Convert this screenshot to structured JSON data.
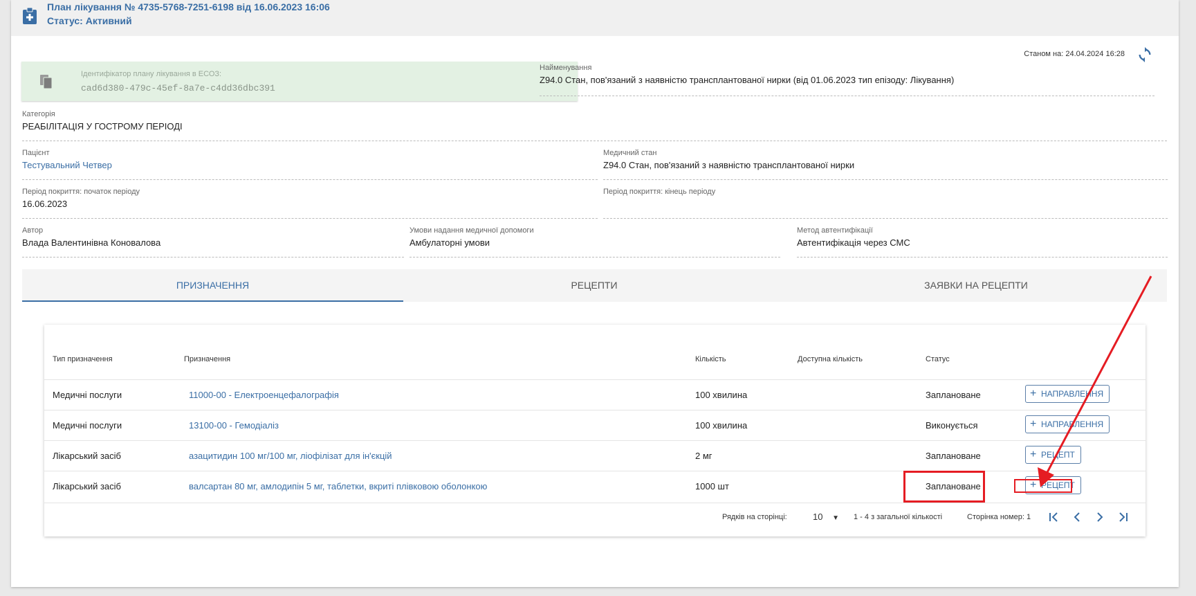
{
  "header": {
    "title": "План лікування № 4735-5768-7251-6198 від 16.06.2023 16:06",
    "status": "Статус: Активний"
  },
  "as_of": "Станом на: 24.04.2024 16:28",
  "ehealth_id": {
    "label": "Ідентифікатор плану лікування в ЕСОЗ:",
    "value": "cad6d380-479c-45ef-8a7e-c4dd36dbc391"
  },
  "fields": {
    "name": {
      "label": "Найменування",
      "value": "Z94.0 Стан, пов'язаний з наявністю трансплантованої нирки (від 01.06.2023 тип епізоду: Лікування)"
    },
    "category": {
      "label": "Категорія",
      "value": "РЕАБІЛІТАЦІЯ У ГОСТРОМУ ПЕРІОДІ"
    },
    "patient": {
      "label": "Пацієнт",
      "value": "Тестувальний Четвер"
    },
    "condition": {
      "label": "Медичний стан",
      "value": "Z94.0 Стан, пов'язаний з наявністю трансплантованої нирки"
    },
    "period_start": {
      "label": "Період покриття: початок періоду",
      "value": "16.06.2023"
    },
    "period_end": {
      "label": "Період покриття: кінець періоду",
      "value": ""
    },
    "author": {
      "label": "Автор",
      "value": "Влада Валентинівна Коновалова"
    },
    "care_conditions": {
      "label": "Умови надання медичної допомоги",
      "value": "Амбулаторні умови"
    },
    "auth_method": {
      "label": "Метод автентифікації",
      "value": "Автентифікація через СМС"
    }
  },
  "tabs": [
    "ПРИЗНАЧЕННЯ",
    "РЕЦЕПТИ",
    "ЗАЯВКИ НА РЕЦЕПТИ"
  ],
  "table": {
    "columns": [
      "Тип призначення",
      "Призначення",
      "Кількість",
      "Доступна кількість",
      "Статус"
    ],
    "rows": [
      {
        "type": "Медичні послуги",
        "item": "11000-00 - Електроенцефалографія",
        "qty": "100 хвилина",
        "available": "",
        "status": "Заплановане",
        "action": "НАПРАВЛЕННЯ"
      },
      {
        "type": "Медичні послуги",
        "item": "13100-00 - Гемодіаліз",
        "qty": "100 хвилина",
        "available": "",
        "status": "Виконується",
        "action": "НАПРАВЛЕННЯ"
      },
      {
        "type": "Лікарський засіб",
        "item": "азацитидин 100 мг/100 мг, ліофілізат для ін'єкцій",
        "qty": "2 мг",
        "available": "",
        "status": "Заплановане",
        "action": "РЕЦЕПТ"
      },
      {
        "type": "Лікарський засіб",
        "item": "валсартан 80 мг, амлодипін 5 мг, таблетки, вкриті плівковою оболонкою",
        "qty": "1000 шт",
        "available": "",
        "status": "Заплановане",
        "action": "РЕЦЕПТ"
      }
    ],
    "pagination": {
      "rows_per_page_label": "Рядків на сторінці:",
      "rows_per_page": "10",
      "range": "1 - 4 з загальної кількості",
      "page_label": "Сторінка номер: 1"
    }
  },
  "colors": {
    "accent": "#3a6ea5",
    "annotation": "#e51c23",
    "id_bg": "#e3f1e3"
  }
}
